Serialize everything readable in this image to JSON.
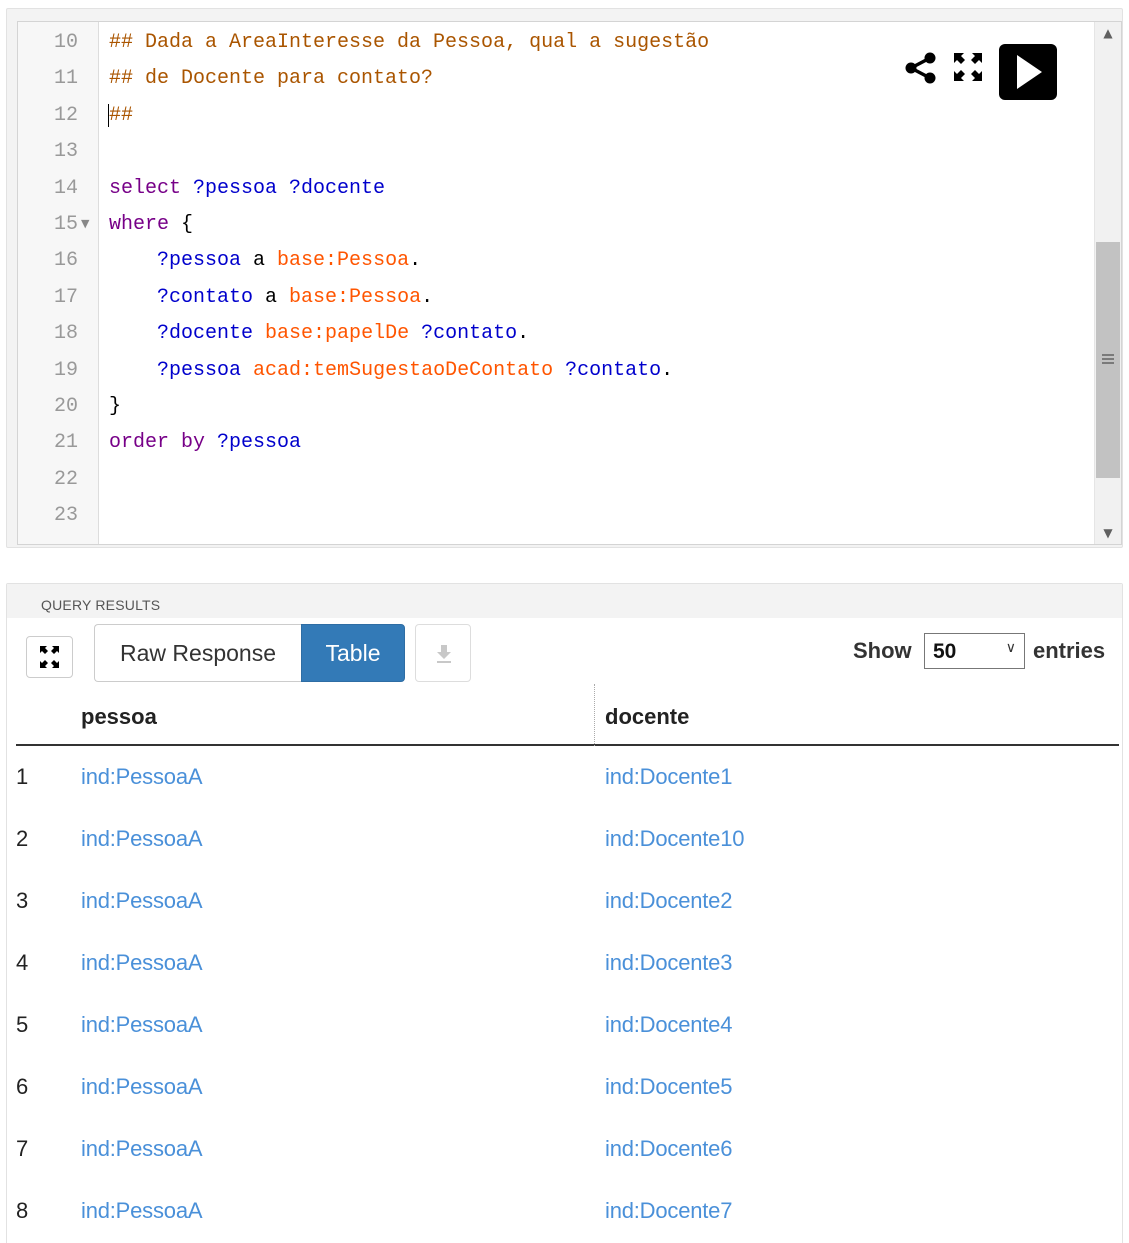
{
  "editor": {
    "lines": [
      {
        "n": "10",
        "tokens": [
          {
            "t": "## Dada a AreaInteresse da Pessoa, qual a sugestão",
            "c": "comment"
          }
        ]
      },
      {
        "n": "11",
        "tokens": [
          {
            "t": "## de Docente para contato?",
            "c": "comment"
          }
        ]
      },
      {
        "n": "12",
        "tokens": [
          {
            "t": "##",
            "c": "comment"
          }
        ]
      },
      {
        "n": "13",
        "tokens": []
      },
      {
        "n": "14",
        "tokens": [
          {
            "t": "select ",
            "c": "kw"
          },
          {
            "t": "?pessoa ?docente",
            "c": "var"
          }
        ]
      },
      {
        "n": "15",
        "fold": true,
        "tokens": [
          {
            "t": "where ",
            "c": "kw"
          },
          {
            "t": "{",
            "c": "plain"
          }
        ]
      },
      {
        "n": "16",
        "tokens": [
          {
            "t": "    ",
            "c": "plain"
          },
          {
            "t": "?pessoa",
            "c": "var"
          },
          {
            "t": " a ",
            "c": "plain"
          },
          {
            "t": "base:Pessoa",
            "c": "pfx"
          },
          {
            "t": ".",
            "c": "plain"
          }
        ]
      },
      {
        "n": "17",
        "tokens": [
          {
            "t": "    ",
            "c": "plain"
          },
          {
            "t": "?contato",
            "c": "var"
          },
          {
            "t": " a ",
            "c": "plain"
          },
          {
            "t": "base:Pessoa",
            "c": "pfx"
          },
          {
            "t": ".",
            "c": "plain"
          }
        ]
      },
      {
        "n": "18",
        "tokens": [
          {
            "t": "    ",
            "c": "plain"
          },
          {
            "t": "?docente",
            "c": "var"
          },
          {
            "t": " ",
            "c": "plain"
          },
          {
            "t": "base:papelDe",
            "c": "pfx"
          },
          {
            "t": " ",
            "c": "plain"
          },
          {
            "t": "?contato",
            "c": "var"
          },
          {
            "t": ".",
            "c": "plain"
          }
        ]
      },
      {
        "n": "19",
        "tokens": [
          {
            "t": "    ",
            "c": "plain"
          },
          {
            "t": "?pessoa",
            "c": "var"
          },
          {
            "t": " ",
            "c": "plain"
          },
          {
            "t": "acad:temSugestaoDeContato",
            "c": "pfx"
          },
          {
            "t": " ",
            "c": "plain"
          },
          {
            "t": "?contato",
            "c": "var"
          },
          {
            "t": ".",
            "c": "plain"
          }
        ]
      },
      {
        "n": "20",
        "tokens": [
          {
            "t": "}",
            "c": "plain"
          }
        ]
      },
      {
        "n": "21",
        "tokens": [
          {
            "t": "order by ",
            "c": "kw"
          },
          {
            "t": "?pessoa",
            "c": "var"
          }
        ]
      },
      {
        "n": "22",
        "tokens": []
      },
      {
        "n": "23",
        "tokens": []
      }
    ],
    "icons": [
      "share-icon",
      "fullscreen-icon",
      "play-icon"
    ]
  },
  "results": {
    "caption": "QUERY RESULTS",
    "raw_label": "Raw Response",
    "table_label": "Table",
    "show_label": "Show",
    "entries_value": "50",
    "entries_label": "entries",
    "columns": [
      "pessoa",
      "docente"
    ],
    "rows": [
      {
        "num": "1",
        "pessoa": "ind:PessoaA",
        "docente": "ind:Docente1"
      },
      {
        "num": "2",
        "pessoa": "ind:PessoaA",
        "docente": "ind:Docente10"
      },
      {
        "num": "3",
        "pessoa": "ind:PessoaA",
        "docente": "ind:Docente2"
      },
      {
        "num": "4",
        "pessoa": "ind:PessoaA",
        "docente": "ind:Docente3"
      },
      {
        "num": "5",
        "pessoa": "ind:PessoaA",
        "docente": "ind:Docente4"
      },
      {
        "num": "6",
        "pessoa": "ind:PessoaA",
        "docente": "ind:Docente5"
      },
      {
        "num": "7",
        "pessoa": "ind:PessoaA",
        "docente": "ind:Docente6"
      },
      {
        "num": "8",
        "pessoa": "ind:PessoaA",
        "docente": "ind:Docente7"
      }
    ]
  },
  "colors": {
    "accent": "#337ab7",
    "link": "#4a90d9",
    "comment": "#aa5500",
    "keyword": "#770088",
    "variable": "#0000cc",
    "prefixed_name": "#ff5500"
  }
}
